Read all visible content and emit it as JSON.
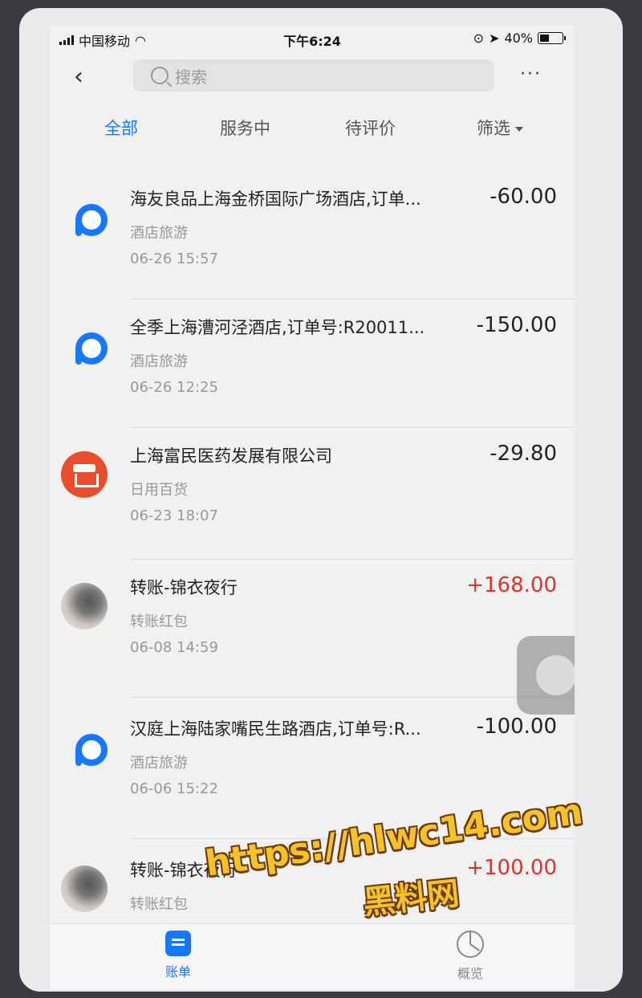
{
  "status_bar": {
    "carrier": "中国移动",
    "time": "下午6:24",
    "battery": "40%"
  },
  "nav": {
    "back_icon": "chevron-left-icon",
    "search_placeholder": "搜索",
    "more_label": "···"
  },
  "tabs": [
    {
      "label": "全部",
      "active": true
    },
    {
      "label": "服务中",
      "active": false
    },
    {
      "label": "待评价",
      "active": false
    },
    {
      "label": "筛选",
      "active": false
    }
  ],
  "transactions": [
    {
      "icon": "pay-icon",
      "title": "海友良品上海金桥国际广场酒店,订单...",
      "category": "酒店旅游",
      "time": "06-26  15:57",
      "amount": "-60.00"
    },
    {
      "icon": "pay-icon",
      "title": "全季上海漕河泾酒店,订单号:R20011...",
      "category": "酒店旅游",
      "time": "06-26  12:25",
      "amount": "-150.00"
    },
    {
      "icon": "shop-icon",
      "title": "上海富民医药发展有限公司",
      "category": "日用百货",
      "time": "06-23  18:07",
      "amount": "-29.80"
    },
    {
      "icon": "avatar",
      "title": "转账-锦衣夜行",
      "category": "转账红包",
      "time": "06-08  14:59",
      "amount": "+168.00"
    },
    {
      "icon": "pay-icon",
      "title": "汉庭上海陆家嘴民生路酒店,订单号:R...",
      "category": "酒店旅游",
      "time": "06-06  15:22",
      "amount": "-100.00"
    },
    {
      "icon": "avatar",
      "title": "转账-锦衣夜行",
      "category": "转账红包",
      "time": "",
      "amount": "+100.00"
    }
  ],
  "tabbar": {
    "bill_label": "账单",
    "overview_label": "概览"
  },
  "watermark": {
    "line1": "https://hlwc14.com",
    "line2": "黑料网"
  },
  "colors": {
    "accent": "#1677ff",
    "positive": "#e0302c"
  }
}
